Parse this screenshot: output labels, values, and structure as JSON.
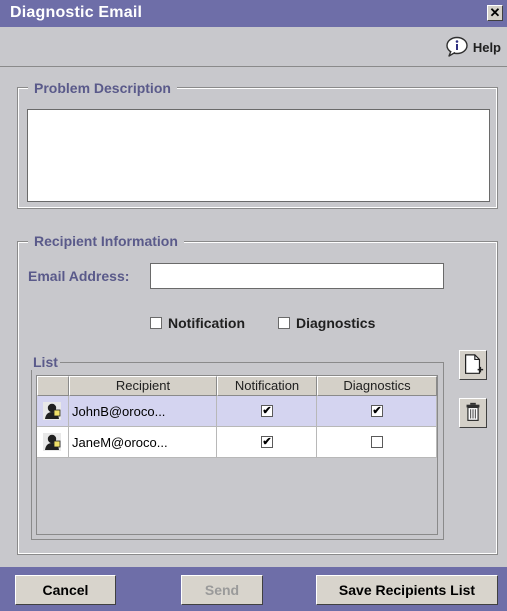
{
  "window": {
    "title": "Diagnostic Email",
    "close_glyph": "✕"
  },
  "help": {
    "label": "Help",
    "icon": "help-bubble-icon"
  },
  "problem": {
    "legend": "Problem Description",
    "value": ""
  },
  "recipient": {
    "legend": "Recipient Information",
    "email_label": "Email Address:",
    "email_value": "",
    "notification_label": "Notification",
    "diagnostics_label": "Diagnostics",
    "notification_checked": false,
    "diagnostics_checked": false
  },
  "list": {
    "legend": "List",
    "columns": [
      "",
      "Recipient",
      "Notification",
      "Diagnostics"
    ],
    "rows": [
      {
        "recipient": "JohnB@oroco...",
        "notification": true,
        "diagnostics": true,
        "selected": true
      },
      {
        "recipient": "JaneM@oroco...",
        "notification": true,
        "diagnostics": false,
        "selected": false
      }
    ]
  },
  "buttons": {
    "cancel": "Cancel",
    "send": "Send",
    "save": "Save Recipients List"
  },
  "colors": {
    "titlebar": "#6e6ea8",
    "legend_text": "#5a5a8a",
    "selected_row": "#d4d4f0",
    "background": "#c8c8cc"
  }
}
